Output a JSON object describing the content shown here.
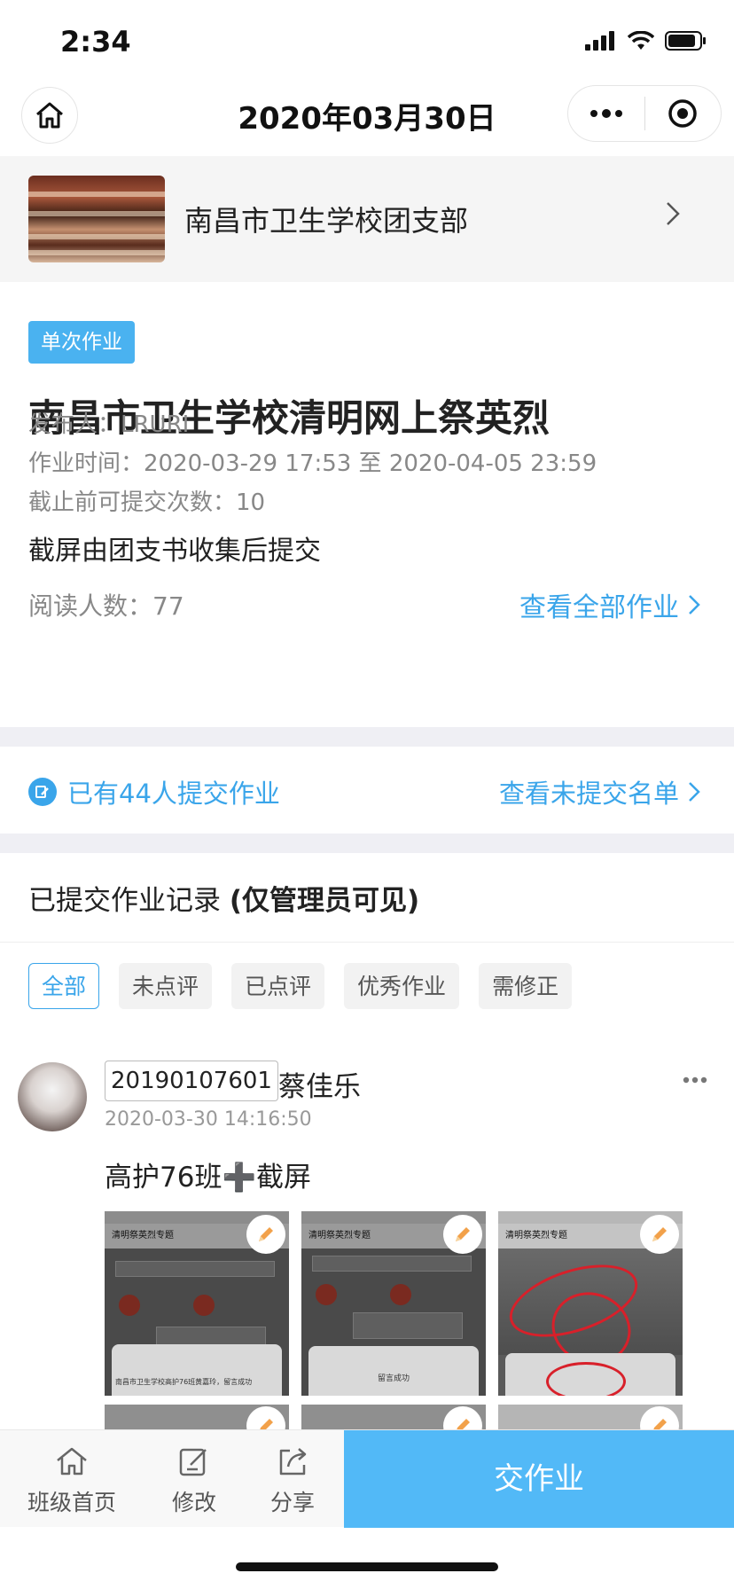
{
  "status_bar": {
    "time": "2:34"
  },
  "nav": {
    "title": "2020年03月30日"
  },
  "org": {
    "name": "南昌市卫生学校团支部"
  },
  "homework": {
    "type_badge": "单次作业",
    "title": "南昌市卫生学校清明网上祭英烈",
    "publisher": "发布人：LRURI",
    "period": "作业时间：2020-03-29 17:53 至 2020-04-05 23:59",
    "submit_limit": "截止前可提交次数：10",
    "description": "截屏由团支书收集后提交",
    "read_count": "阅读人数：77",
    "view_all_label": "查看全部作业"
  },
  "submission_summary": {
    "text": "已有44人提交作业",
    "unsubmitted_link": "查看未提交名单"
  },
  "records": {
    "heading": "已提交作业记录",
    "heading_note": "(仅管理员可见)",
    "filters": [
      "全部",
      "未点评",
      "已点评",
      "优秀作业",
      "需修正"
    ],
    "active_filter": "全部",
    "items": [
      {
        "student_id": "20190107601",
        "name": "蔡佳乐",
        "time": "2020-03-30 14:16:50",
        "text": "高护76班➕截屏",
        "thumb_titles": [
          "清明祭英烈专题",
          "清明祭英烈专题",
          "清明祭英烈专题"
        ],
        "thumb_bottom_captions": [
          "南昌市卫生学校高护76班黄嘉玲，留言成功",
          "留言成功"
        ]
      }
    ]
  },
  "bottom_bar": {
    "tabs": [
      "班级首页",
      "修改",
      "分享"
    ],
    "submit_button": "交作业"
  },
  "colors": {
    "accent": "#3aa5ea",
    "cta": "#52b9f7",
    "badge": "#4ab2f0"
  }
}
